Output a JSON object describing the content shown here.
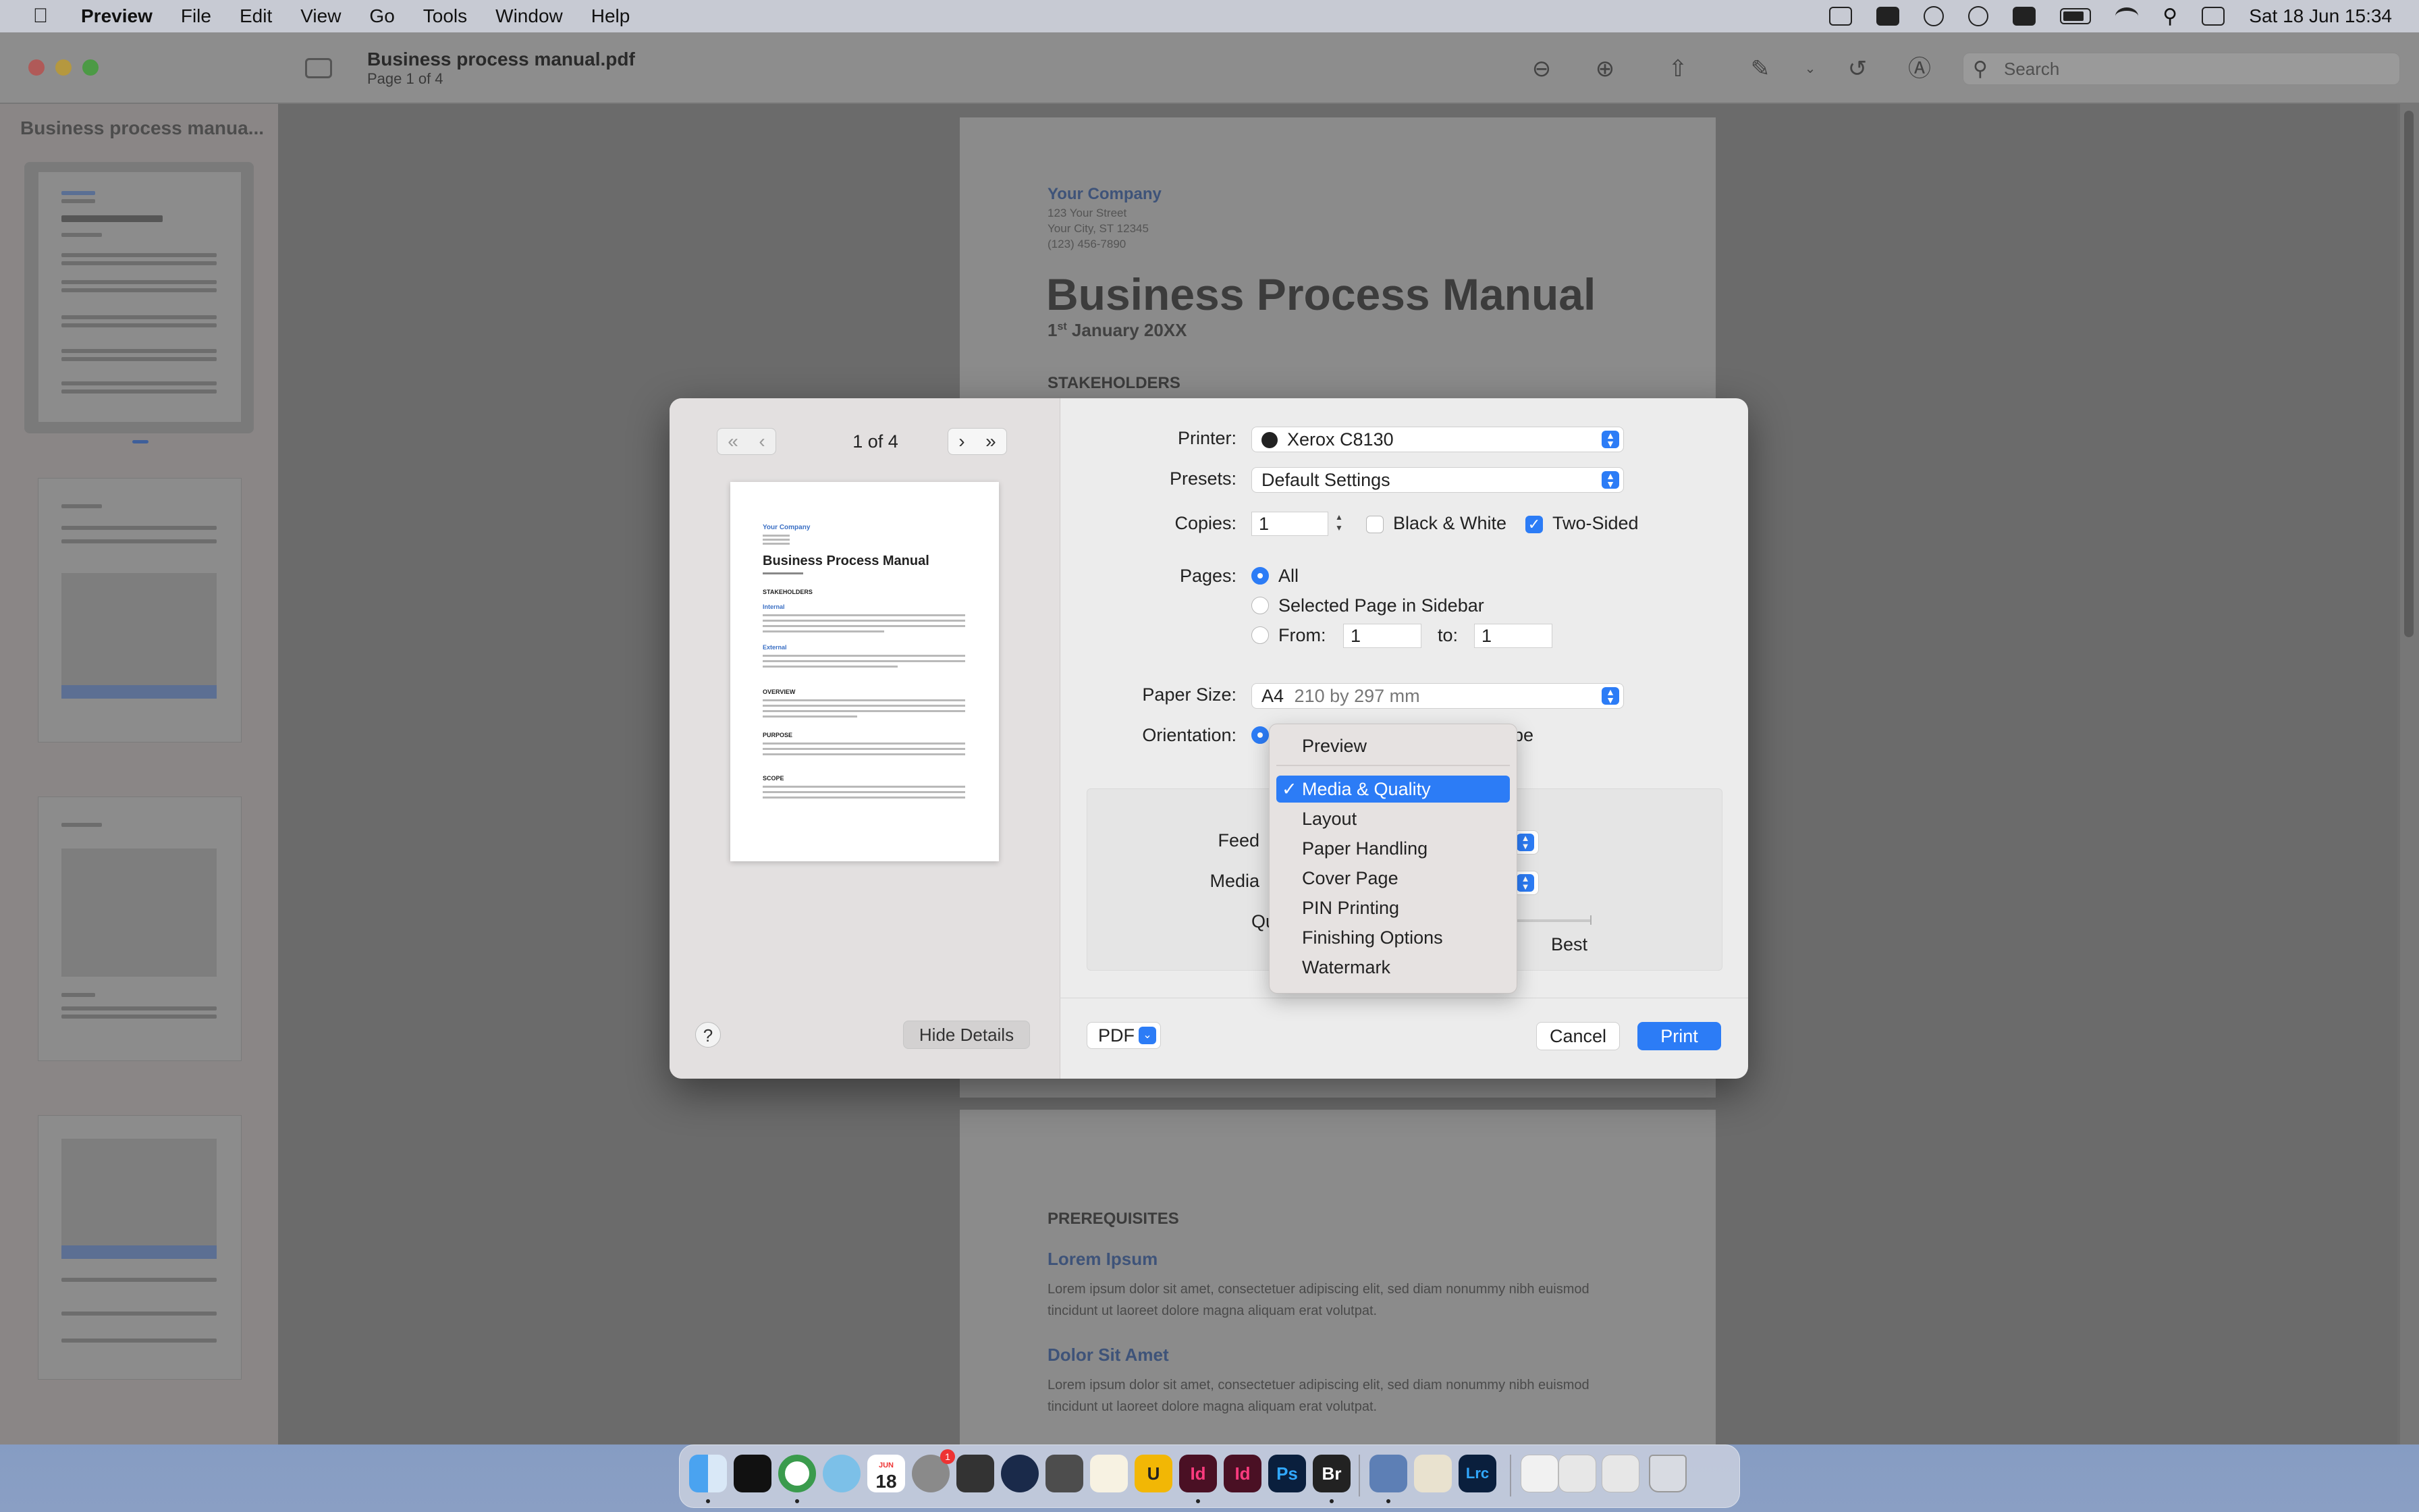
{
  "menubar": {
    "apple": "",
    "items": [
      "Preview",
      "File",
      "Edit",
      "View",
      "Go",
      "Tools",
      "Window",
      "Help"
    ],
    "clock": "Sat 18 Jun  15:34"
  },
  "window": {
    "title": "Business process manual.pdf",
    "subtitle": "Page 1 of 4",
    "search_placeholder": "Search"
  },
  "sidebar": {
    "title": "Business process manua..."
  },
  "page1": {
    "company": "Your Company",
    "address": [
      "123 Your Street",
      "Your City, ST 12345",
      "(123) 456-7890"
    ],
    "title": "Business Process Manual",
    "date_num": "1",
    "date_sup": "st",
    "date_rest": " January 20XX",
    "section": "STAKEHOLDERS"
  },
  "page2": {
    "section": "PREREQUISITES",
    "sub1": "Lorem Ipsum",
    "body1": "Lorem ipsum dolor sit amet, consectetuer adipiscing elit, sed diam nonummy nibh euismod tincidunt ut laoreet dolore magna aliquam erat volutpat.",
    "sub2": "Dolor Sit Amet",
    "body2": "Lorem ipsum dolor sit amet, consectetuer adipiscing elit, sed diam nonummy nibh euismod tincidunt ut laoreet dolore magna aliquam erat volutpat."
  },
  "dialog": {
    "page_count": "1 of 4",
    "preview": {
      "company": "Your Company",
      "title": "Business Process Manual",
      "headings": [
        "STAKEHOLDERS",
        "Internal",
        "External",
        "OVERVIEW",
        "PURPOSE",
        "SCOPE"
      ]
    },
    "printer_label": "Printer:",
    "printer_value": "Xerox C8130",
    "presets_label": "Presets:",
    "presets_value": "Default Settings",
    "copies_label": "Copies:",
    "copies_value": "1",
    "bw_label": "Black & White",
    "bw_checked": false,
    "two_sided_label": "Two-Sided",
    "two_sided_checked": true,
    "pages_label": "Pages:",
    "pages_all": "All",
    "pages_selected": "Selected Page in Sidebar",
    "pages_from": "From:",
    "from_value": "1",
    "pages_to": "to:",
    "to_value": "1",
    "paper_label": "Paper Size:",
    "paper_value": "A4",
    "paper_dims": "210 by 297 mm",
    "orientation_label": "Orientation:",
    "orientation_partial": "pe",
    "feed_label": "Feed",
    "media_label": "Media",
    "quality_label": "Qu",
    "quality_best": "Best",
    "help": "?",
    "hide_details": "Hide Details",
    "pdf": "PDF",
    "cancel": "Cancel",
    "print": "Print"
  },
  "dropdown": {
    "items": [
      "Preview",
      "Media & Quality",
      "Layout",
      "Paper Handling",
      "Cover Page",
      "PIN Printing",
      "Finishing Options",
      "Watermark"
    ],
    "selected": "Media & Quality",
    "check": "✓"
  },
  "dock": {
    "calendar_month": "JUN",
    "calendar_day": "18",
    "badge": "1",
    "labels": [
      "Id",
      "Id",
      "Ps",
      "Br",
      "Lrc",
      "U"
    ]
  },
  "colors": {
    "accent": "#2c7cf6",
    "link": "#3e5379"
  }
}
